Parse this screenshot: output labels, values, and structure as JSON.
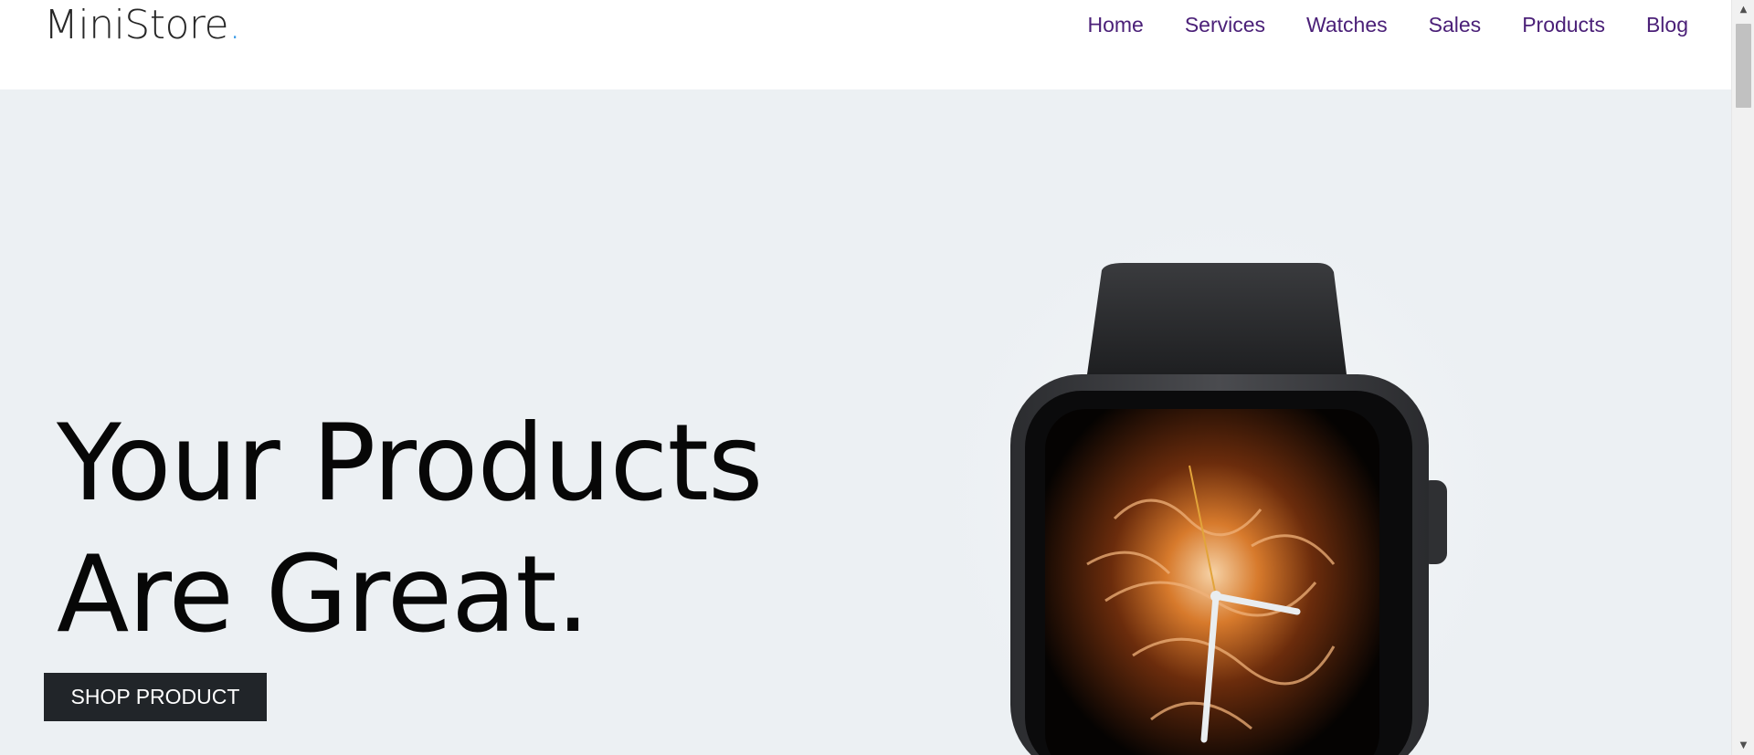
{
  "header": {
    "logo_text": "MiniStore",
    "logo_dot": ".",
    "nav": [
      {
        "label": "Home"
      },
      {
        "label": "Services"
      },
      {
        "label": "Watches"
      },
      {
        "label": "Sales"
      },
      {
        "label": "Products"
      },
      {
        "label": "Blog"
      }
    ]
  },
  "hero": {
    "headline_line1": "Your Products",
    "headline_line2": "Are Great.",
    "cta_label": "SHOP PRODUCT",
    "image_subject": "smartwatch-with-flame-watchface"
  },
  "scrollbar": {
    "up_glyph": "▲",
    "down_glyph": "▼"
  },
  "colors": {
    "nav_link": "#4b2078",
    "hero_background": "#ecf0f3",
    "cta_background": "#212529",
    "logo_accent": "#43a0e8"
  }
}
